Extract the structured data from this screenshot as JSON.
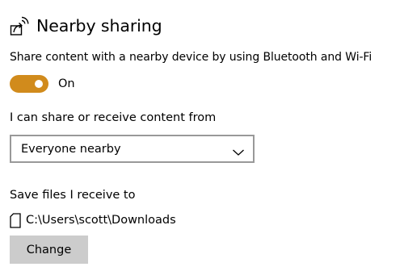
{
  "header": {
    "title": "Nearby sharing",
    "icon": "nearby-sharing-icon"
  },
  "sharing": {
    "description": "Share content with a nearby device by using Bluetooth and Wi-Fi",
    "toggle_state": "On",
    "toggle_on": true,
    "accent_color": "#d18b1c"
  },
  "share_from": {
    "label": "I can share or receive content from",
    "selected": "Everyone nearby"
  },
  "save_location": {
    "label": "Save files I receive to",
    "icon": "document-icon",
    "path": "C:\\Users\\scott\\Downloads",
    "change_label": "Change"
  }
}
